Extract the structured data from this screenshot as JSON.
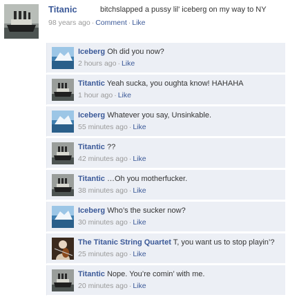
{
  "post": {
    "author": "Titanic",
    "text": "bitchslapped a pussy lil' iceberg on my way to NY",
    "time": "98 years ago",
    "separator": "·",
    "actions": [
      "Comment",
      "Like"
    ],
    "avatar_icon": "ship-icon"
  },
  "comments": [
    {
      "author": "Iceberg",
      "text": "Oh did you now?",
      "time": "2 hours ago",
      "like": "Like",
      "avatar_icon": "iceberg-icon"
    },
    {
      "author": "Titantic",
      "text": "Yeah sucka, you oughta know! HAHAHA",
      "time": "1 hour ago",
      "like": "Like",
      "avatar_icon": "ship-icon"
    },
    {
      "author": "Iceberg",
      "text": "Whatever you say, Unsinkable.",
      "time": "55 minutes ago",
      "like": "Like",
      "avatar_icon": "iceberg-icon"
    },
    {
      "author": "Titantic",
      "text": "??",
      "time": "42 minutes ago",
      "like": "Like",
      "avatar_icon": "ship-icon"
    },
    {
      "author": "Titantic",
      "text": "…Oh you motherfucker.",
      "time": "38 minutes ago",
      "like": "Like",
      "avatar_icon": "ship-icon"
    },
    {
      "author": "Iceberg",
      "text": "Who’s the sucker now?",
      "time": "30 minutes ago",
      "like": "Like",
      "avatar_icon": "iceberg-icon"
    },
    {
      "author": "The Titanic String Quartet",
      "text": "T, you want us to stop playin’?",
      "time": "25 minutes ago",
      "like": "Like",
      "avatar_icon": "violinist-icon"
    },
    {
      "author": "Titantic",
      "text": "Nope.  You’re comin’ with me.",
      "time": "20 minutes ago",
      "like": "Like",
      "avatar_icon": "ship-icon"
    }
  ],
  "colors": {
    "link": "#3b5998",
    "meta": "#999999",
    "comment_bg": "#eceff5"
  }
}
